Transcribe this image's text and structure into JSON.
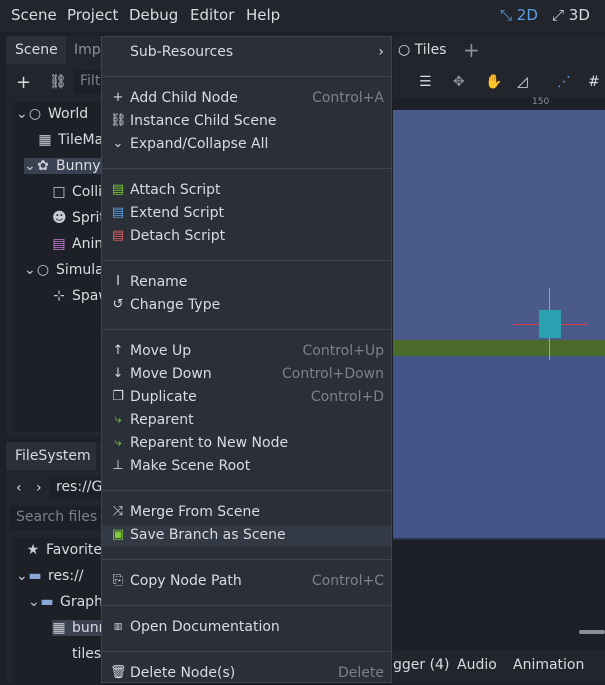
{
  "menubar": {
    "items": [
      "Scene",
      "Project",
      "Debug",
      "Editor",
      "Help"
    ],
    "mode_2d": "2D",
    "mode_3d": "3D"
  },
  "scene_dock": {
    "tabs": [
      "Scene",
      "Imp"
    ],
    "filter_placeholder": "Filt",
    "tree": [
      {
        "label": "World",
        "icon": "circle-node-icon"
      },
      {
        "label": "TileMa",
        "icon": "tilemap-icon"
      },
      {
        "label": "Bunny",
        "icon": "bunny-node-icon"
      },
      {
        "label": "Collis",
        "icon": "collision-shape-icon"
      },
      {
        "label": "Sprit",
        "icon": "sprite-icon"
      },
      {
        "label": "Anim",
        "icon": "animation-player-icon"
      },
      {
        "label": "Simula",
        "icon": "circle-node-icon"
      },
      {
        "label": "Spaw",
        "icon": "position-node-icon"
      }
    ]
  },
  "viewport": {
    "tab_label": "Tiles",
    "ruler_value": "150"
  },
  "filesystem": {
    "tab": "FileSystem",
    "path": "res://G",
    "search_placeholder": "Search files",
    "tree": [
      {
        "label": "Favorites",
        "icon": "star-icon"
      },
      {
        "label": "res://",
        "icon": "folder-icon"
      },
      {
        "label": "Graph",
        "icon": "folder-icon"
      },
      {
        "label": "bunn",
        "icon": "image-file-icon"
      },
      {
        "label": "tiles.",
        "icon": "file-icon"
      }
    ]
  },
  "bottom_panel": {
    "tabs": [
      "gger (4)",
      "Audio",
      "Animation"
    ]
  },
  "context_menu": {
    "items": [
      {
        "label": "Sub-Resources",
        "shortcut": "",
        "icon": "",
        "submenu": true
      },
      {
        "label": "Add Child Node",
        "shortcut": "Control+A",
        "icon": "plus-icon"
      },
      {
        "label": "Instance Child Scene",
        "shortcut": "",
        "icon": "link-icon"
      },
      {
        "label": "Expand/Collapse All",
        "shortcut": "",
        "icon": "chevron-down-icon"
      },
      {
        "label": "Attach Script",
        "shortcut": "",
        "icon": "script-add-icon"
      },
      {
        "label": "Extend Script",
        "shortcut": "",
        "icon": "script-extend-icon"
      },
      {
        "label": "Detach Script",
        "shortcut": "",
        "icon": "script-remove-icon"
      },
      {
        "label": "Rename",
        "shortcut": "",
        "icon": "rename-icon"
      },
      {
        "label": "Change Type",
        "shortcut": "",
        "icon": "rotate-icon"
      },
      {
        "label": "Move Up",
        "shortcut": "Control+Up",
        "icon": "move-up-icon"
      },
      {
        "label": "Move Down",
        "shortcut": "Control+Down",
        "icon": "move-down-icon"
      },
      {
        "label": "Duplicate",
        "shortcut": "Control+D",
        "icon": "duplicate-icon"
      },
      {
        "label": "Reparent",
        "shortcut": "",
        "icon": "reparent-icon"
      },
      {
        "label": "Reparent to New Node",
        "shortcut": "",
        "icon": "reparent-new-icon"
      },
      {
        "label": "Make Scene Root",
        "shortcut": "",
        "icon": "scene-root-icon"
      },
      {
        "label": "Merge From Scene",
        "shortcut": "",
        "icon": "merge-icon"
      },
      {
        "label": "Save Branch as Scene",
        "shortcut": "",
        "icon": "save-branch-icon"
      },
      {
        "label": "Copy Node Path",
        "shortcut": "Control+C",
        "icon": "copy-path-icon"
      },
      {
        "label": "Open Documentation",
        "shortcut": "",
        "icon": "doc-icon"
      },
      {
        "label": "Delete Node(s)",
        "shortcut": "Delete",
        "icon": "trash-icon"
      }
    ],
    "highlighted": "Save Branch as Scene"
  },
  "colors": {
    "accent": "#5c9fe5",
    "menu_bg": "#2a2f38",
    "viewport_bg": "#4a5a8a",
    "ground": "#4a6a2a"
  }
}
